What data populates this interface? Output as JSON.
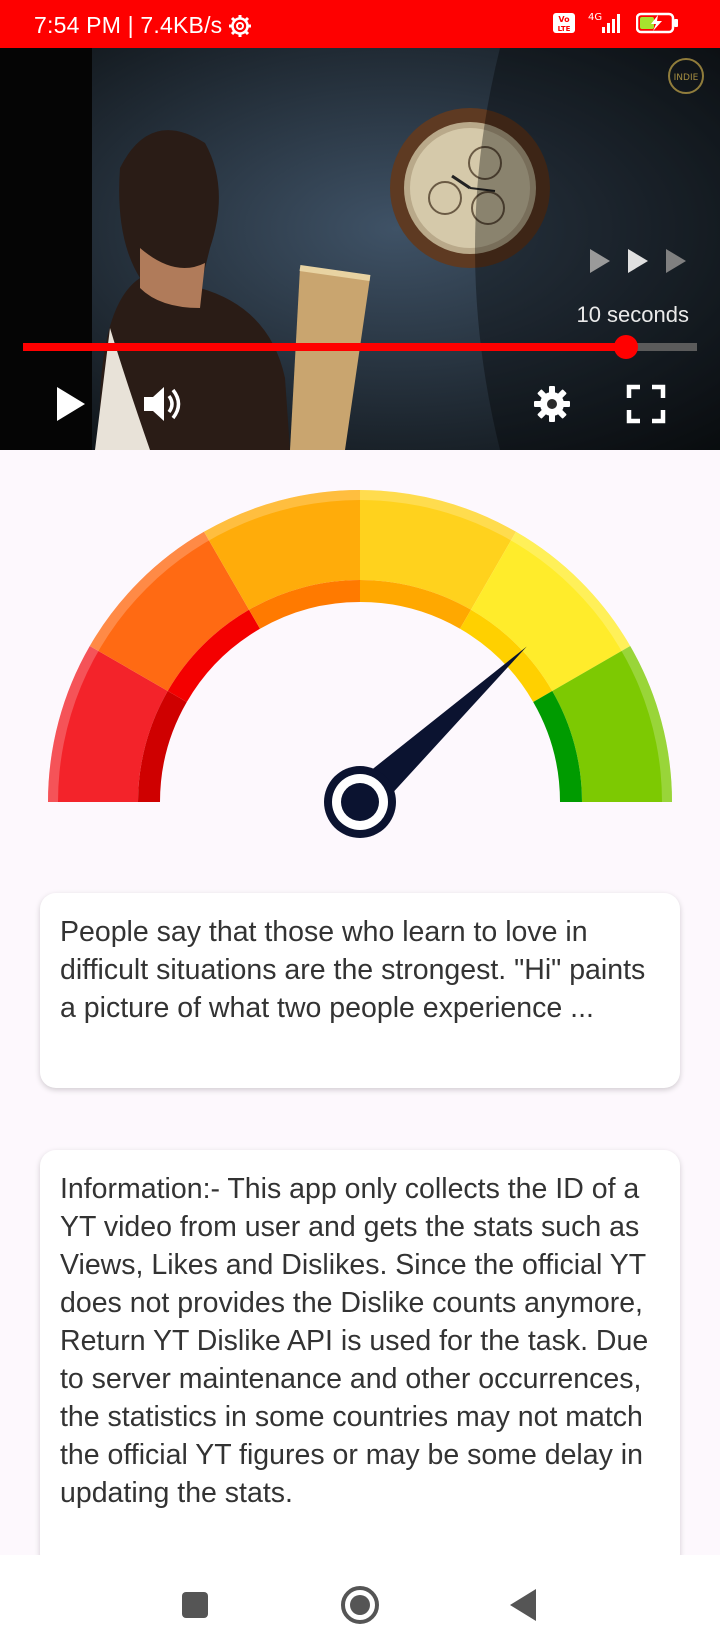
{
  "status_bar": {
    "time_speed": "7:54 PM | 7.4KB/s",
    "network": "4G",
    "volte": "Vo LTE",
    "icons": [
      "settings-gear-icon",
      "volte-icon",
      "signal-icon",
      "battery-charging-icon"
    ]
  },
  "video": {
    "seconds_label": "10 seconds",
    "progress": 0.895,
    "icons": [
      "skip-forward-icon",
      "play-icon",
      "volume-icon",
      "settings-icon",
      "fullscreen-icon"
    ],
    "watermark": "INDIE"
  },
  "gauge": {
    "needle_angle_deg": 43,
    "segments_colors": [
      "#f3232a",
      "#ff6a13",
      "#ffac0a",
      "#ffd21d",
      "#ffec2b",
      "#7dc902"
    ],
    "needle_color": "#0b1330"
  },
  "description_card": {
    "text": "People say that those who learn to love in difficult situations are the strongest. \"Hi\" paints a picture of what two people experience ..."
  },
  "info_card": {
    "text": "Information:- This app only collects the ID of a YT video from user and gets the stats such as Views, Likes and Dislikes. Since the official YT does not provides the Dislike counts anymore, Return YT Dislike API is used for the task. Due to server maintenance and other occurrences, the statistics in some countries may not match the official YT figures or may be some delay in updating the stats."
  },
  "nav_bar": {
    "icons": [
      "recents-square-icon",
      "home-circle-icon",
      "back-triangle-icon"
    ]
  }
}
